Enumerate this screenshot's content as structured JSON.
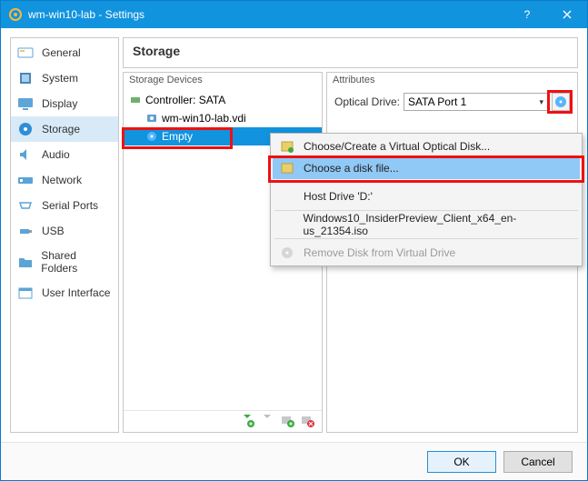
{
  "title": "wm-win10-lab - Settings",
  "sidebar": {
    "items": [
      {
        "label": "General"
      },
      {
        "label": "System"
      },
      {
        "label": "Display"
      },
      {
        "label": "Storage"
      },
      {
        "label": "Audio"
      },
      {
        "label": "Network"
      },
      {
        "label": "Serial Ports"
      },
      {
        "label": "USB"
      },
      {
        "label": "Shared Folders"
      },
      {
        "label": "User Interface"
      }
    ],
    "selected_index": 3
  },
  "page_header": "Storage",
  "storage": {
    "panel_title": "Storage Devices",
    "controller": "Controller: SATA",
    "attachments": [
      {
        "label": "wm-win10-lab.vdi"
      },
      {
        "label": "Empty"
      }
    ],
    "selected_attachment_index": 1
  },
  "attributes": {
    "panel_title": "Attributes",
    "optical_drive_label": "Optical Drive:",
    "optical_drive_value": "SATA Port 1"
  },
  "context_menu": {
    "items": [
      {
        "label": "Choose/Create a Virtual Optical Disk...",
        "enabled": true
      },
      {
        "label": "Choose a disk file...",
        "enabled": true,
        "highlight": true
      },
      {
        "label": "Host Drive 'D:'",
        "enabled": true
      },
      {
        "label": "Windows10_InsiderPreview_Client_x64_en-us_21354.iso",
        "enabled": true
      },
      {
        "label": "Remove Disk from Virtual Drive",
        "enabled": false
      }
    ]
  },
  "footer": {
    "ok": "OK",
    "cancel": "Cancel"
  }
}
